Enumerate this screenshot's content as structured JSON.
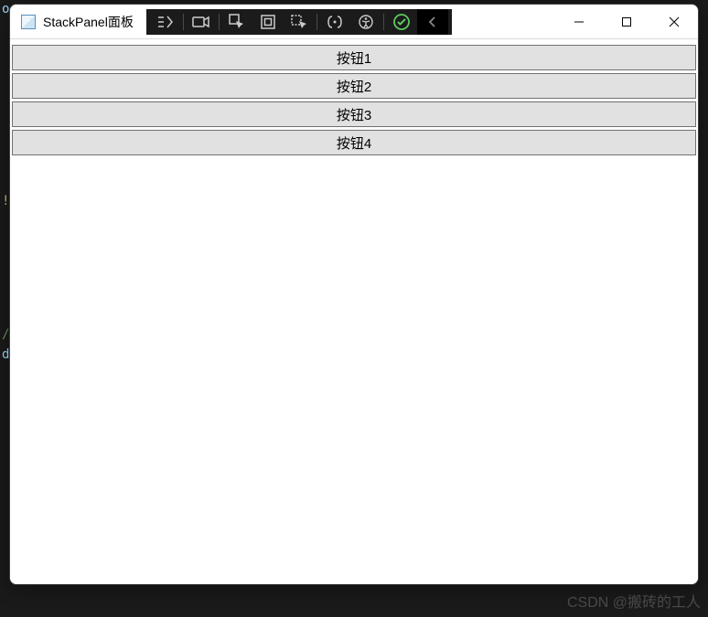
{
  "background_hints": {
    "t0": "o",
    "t1": "!",
    "t2": "/",
    "t3": "d"
  },
  "window": {
    "title": "StackPanel面板",
    "controls": {
      "minimize_glyph": "—",
      "maximize_glyph": "",
      "close_glyph": ""
    }
  },
  "debug_toolbar": {
    "items": [
      {
        "name": "go-to-live-tree-icon"
      },
      {
        "name": "toggle-recorder-icon"
      },
      {
        "name": "select-element-icon"
      },
      {
        "name": "display-layout-icon"
      },
      {
        "name": "track-focus-icon"
      },
      {
        "name": "xaml-binding-icon"
      },
      {
        "name": "accessibility-icon"
      },
      {
        "name": "hot-reload-icon"
      },
      {
        "name": "chevron-left-icon"
      }
    ]
  },
  "buttons": [
    {
      "label": "按钮1"
    },
    {
      "label": "按钮2"
    },
    {
      "label": "按钮3"
    },
    {
      "label": "按钮4"
    }
  ],
  "watermark": "CSDN @搬砖的工人"
}
